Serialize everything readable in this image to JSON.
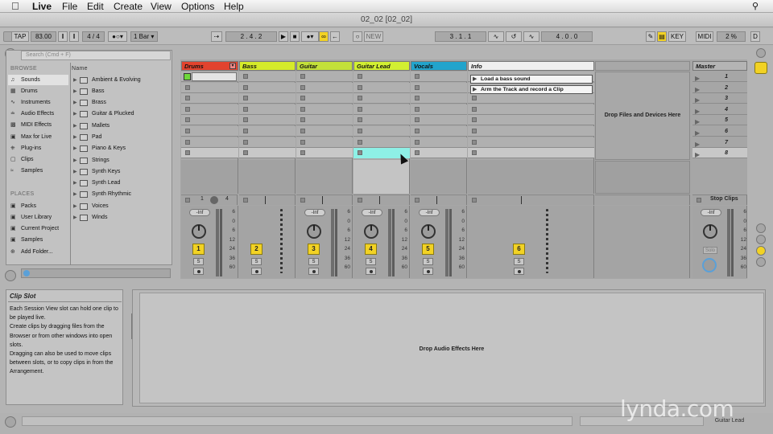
{
  "menubar": {
    "app": "Live",
    "items": [
      "File",
      "Edit",
      "Create",
      "View",
      "Options",
      "Help"
    ]
  },
  "window": {
    "title": "02_02  [02_02]"
  },
  "control": {
    "tap": "TAP",
    "tempo": "83.00",
    "sig": "4 / 4",
    "quant": "1 Bar",
    "position": "2 .  4 .  2",
    "new": "NEW",
    "loop_start": "3 .  1 .  1",
    "loop_len": "4 .  0 .  0",
    "key": "KEY",
    "midi": "MIDI",
    "cpu": "2 %",
    "d": "D"
  },
  "browser": {
    "search_placeholder": "Search (Cmd + F)",
    "browse_label": "BROWSE",
    "places_label": "PLACES",
    "name_header": "Name",
    "categories": [
      "Sounds",
      "Drums",
      "Instruments",
      "Audio Effects",
      "MIDI Effects",
      "Max for Live",
      "Plug-ins",
      "Clips",
      "Samples"
    ],
    "places": [
      "Packs",
      "User Library",
      "Current Project",
      "Samples",
      "Add Folder..."
    ],
    "folders": [
      "Ambient & Evolving",
      "Bass",
      "Brass",
      "Guitar & Plucked",
      "Mallets",
      "Pad",
      "Piano & Keys",
      "Strings",
      "Synth Keys",
      "Synth Lead",
      "Synth Rhythmic",
      "Voices",
      "Winds"
    ]
  },
  "tracks": [
    {
      "name": "Drums",
      "color": "#e2432e",
      "num": "1"
    },
    {
      "name": "Bass",
      "color": "#d5ea2a",
      "num": "2"
    },
    {
      "name": "Guitar",
      "color": "#c3e03a",
      "num": "3"
    },
    {
      "name": "Guitar Lead",
      "color": "#d2ef32",
      "num": "4"
    },
    {
      "name": "Vocals",
      "color": "#22a4cc",
      "num": "5"
    },
    {
      "name": "Info",
      "color": "#efefef",
      "num": "6"
    }
  ],
  "master": {
    "name": "Master",
    "stop": "Stop Clips",
    "scenes": [
      "1",
      "2",
      "3",
      "4",
      "5",
      "6",
      "7",
      "8"
    ],
    "solo": "Solo"
  },
  "drum_rack_nums": [
    "1",
    "4"
  ],
  "info_clips": [
    "Load a bass sound",
    "Arm the Track and record a Clip"
  ],
  "drop_devices": "Drop Files and Devices Here",
  "drop_effects": "Drop Audio Effects Here",
  "inf_label": "-Inf",
  "meter_ticks": [
    "6",
    "0",
    "6",
    "12",
    "24",
    "36",
    "60"
  ],
  "solo_label": "S",
  "help": {
    "title": "Clip Slot",
    "text": "Each Session View slot can hold one clip to be played live.\nCreate clips by dragging files from the Browser or from other windows into open slots.\nDragging can also be used to move clips between slots, or to copy clips in from the Arrangement."
  },
  "status": {
    "track": "Guitar Lead"
  },
  "watermark": "lynda.com"
}
